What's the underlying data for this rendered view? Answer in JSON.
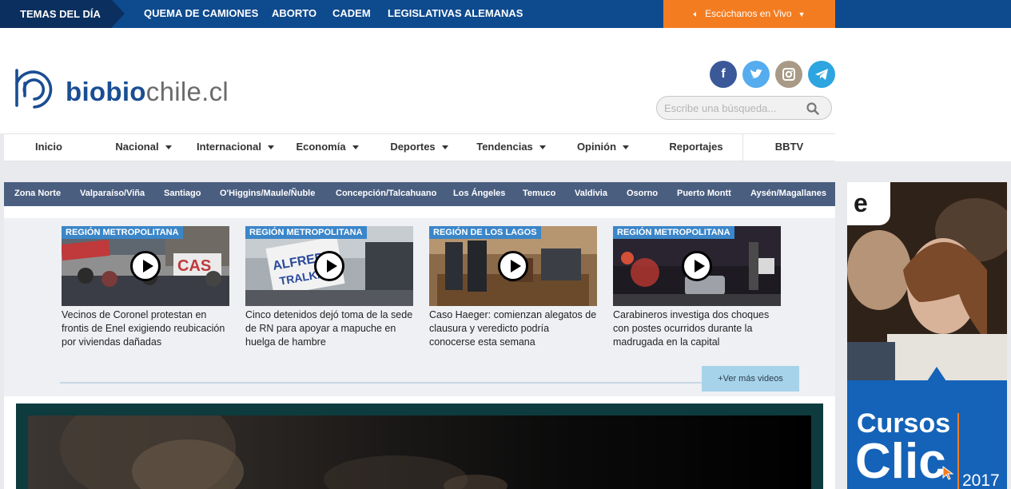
{
  "topbar": {
    "temas_label": "TEMAS DEL DÍA",
    "topics": [
      "QUEMA DE CAMIONES",
      "ABORTO",
      "CADEM",
      "LEGISLATIVAS ALEMANAS"
    ],
    "listen_label": "Escúchanos en Vivo",
    "listen_color": "#f47c20"
  },
  "header": {
    "logo_part1": "biobio",
    "logo_part2": "chile.cl",
    "brand_color": "#1a4d93",
    "social": [
      {
        "name": "facebook-icon",
        "glyph": "f",
        "color": "#3b5998"
      },
      {
        "name": "twitter-icon",
        "glyph": "t",
        "color": "#55acee"
      },
      {
        "name": "instagram-icon",
        "glyph": "◎",
        "color": "#a89a87"
      },
      {
        "name": "telegram-icon",
        "glyph": "➤",
        "color": "#2ca5e0"
      }
    ],
    "search_placeholder": "Escribe una búsqueda..."
  },
  "nav": {
    "items": [
      {
        "label": "Inicio",
        "dropdown": false
      },
      {
        "label": "Nacional",
        "dropdown": true
      },
      {
        "label": "Internacional",
        "dropdown": true
      },
      {
        "label": "Economía",
        "dropdown": true
      },
      {
        "label": "Deportes",
        "dropdown": true
      },
      {
        "label": "Tendencias",
        "dropdown": true
      },
      {
        "label": "Opinión",
        "dropdown": true
      },
      {
        "label": "Reportajes",
        "dropdown": false
      },
      {
        "label": "BBTV",
        "dropdown": false
      }
    ]
  },
  "regions": [
    "Zona Norte",
    "Valparaíso/Viña",
    "Santiago",
    "O'Higgins/Maule/Ñuble",
    "Concepción/Talcahuano",
    "Los Ángeles",
    "Temuco",
    "Valdivia",
    "Osorno",
    "Puerto Montt",
    "Aysén/Magallanes"
  ],
  "videos": {
    "cards": [
      {
        "tag": "REGIÓN METROPOLITANA",
        "caption": "Vecinos de Coronel protestan en frontis de Enel exigiendo reubicación por viviendas dañadas"
      },
      {
        "tag": "REGIÓN METROPOLITANA",
        "caption": "Cinco detenidos dejó toma de la sede de RN para apoyar a mapuche en huelga de hambre"
      },
      {
        "tag": "REGIÓN DE LOS LAGOS",
        "caption": "Caso Haeger: comienzan alegatos de clausura y veredicto podría conocerse esta semana"
      },
      {
        "tag": "REGIÓN METROPOLITANA",
        "caption": "Carabineros investiga dos choques con postes ocurridos durante la madrugada en la capital"
      }
    ],
    "more_label": "+Ver más videos"
  },
  "ad": {
    "logo": "e",
    "line1": "Cursos",
    "line2": "Clic",
    "year": "2017"
  }
}
